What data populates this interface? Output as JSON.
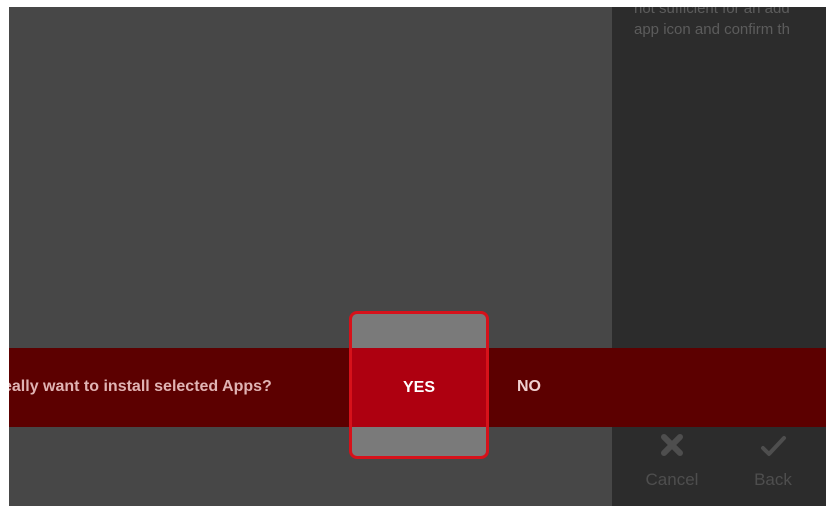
{
  "help_panel": {
    "lines": [
      "not sufficient for an add",
      "app icon and confirm th"
    ]
  },
  "dialog": {
    "message": "eally want to install selected Apps?",
    "yes_label": "YES",
    "no_label": "NO"
  },
  "footer": {
    "cancel": {
      "label": "Cancel",
      "icon": "x-icon"
    },
    "back": {
      "label": "Back",
      "icon": "checkmark-icon"
    }
  },
  "colors": {
    "background": "#474747",
    "panel": "#2c2c2c",
    "dialog_bar": "#5c0000",
    "yes_active": "#ae0010",
    "highlight_border": "#d6111a"
  }
}
